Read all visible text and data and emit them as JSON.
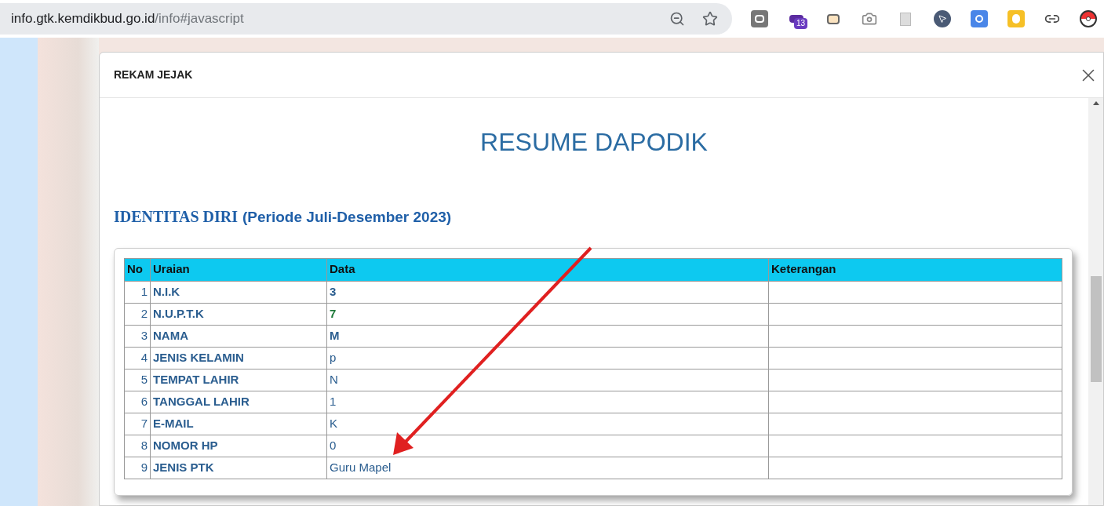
{
  "browser": {
    "address_host": "info.gtk.kemdikbud.go.id",
    "address_path": "/info#javascript",
    "extension_badge": "13"
  },
  "modal": {
    "title": "REKAM JEJAK",
    "heading": "RESUME DAPODIK",
    "section_title": "IDENTITAS DIRI",
    "section_period": "(Periode Juli-Desember 2023)",
    "table": {
      "columns": [
        "No",
        "Uraian",
        "Data",
        "Keterangan"
      ],
      "rows": [
        {
          "no": "1",
          "uraian": "N.I.K",
          "data": "3",
          "kind": "bold"
        },
        {
          "no": "2",
          "uraian": "N.U.P.T.K",
          "data": "7",
          "kind": "highlight"
        },
        {
          "no": "3",
          "uraian": "NAMA",
          "data": "M",
          "kind": "bold"
        },
        {
          "no": "4",
          "uraian": "JENIS KELAMIN",
          "data": "p",
          "kind": "plain"
        },
        {
          "no": "5",
          "uraian": "TEMPAT LAHIR",
          "data": "N",
          "kind": "plain"
        },
        {
          "no": "6",
          "uraian": "TANGGAL LAHIR",
          "data": "1",
          "kind": "plain"
        },
        {
          "no": "7",
          "uraian": "E-MAIL",
          "data": "K",
          "kind": "plain"
        },
        {
          "no": "8",
          "uraian": "NOMOR HP",
          "data": "0",
          "kind": "plain"
        },
        {
          "no": "9",
          "uraian": "JENIS PTK",
          "data": "Guru Mapel",
          "kind": "plain"
        }
      ]
    }
  }
}
